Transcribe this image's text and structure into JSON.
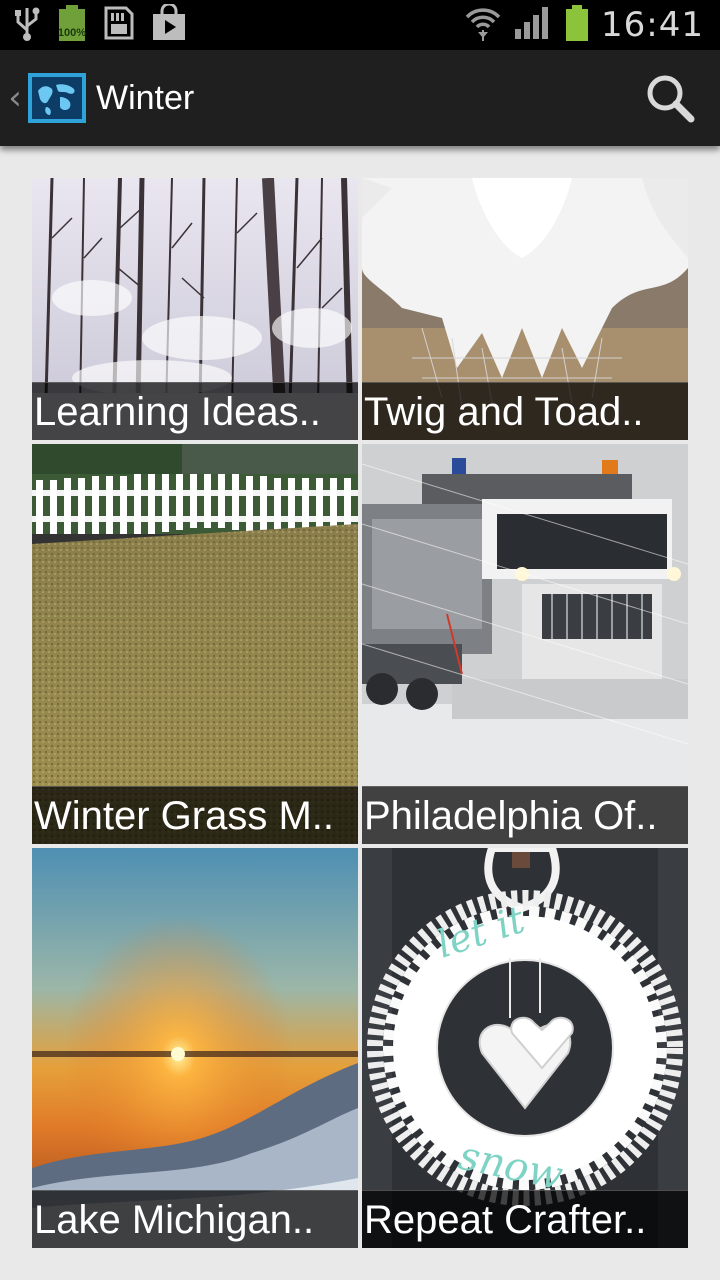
{
  "status_bar": {
    "time": "16:41",
    "battery_percent_label": "100%",
    "icons": [
      "usb-icon",
      "battery-full-icon",
      "sd-card-icon",
      "play-store-icon",
      "wifi-icon",
      "signal-icon",
      "battery-charging-icon"
    ]
  },
  "action_bar": {
    "title": "Winter",
    "up_icon": "chevron-left-icon",
    "app_icon": "globe-icon",
    "search_icon": "search-icon"
  },
  "grid": {
    "items": [
      {
        "caption": "Learning Ideas.."
      },
      {
        "caption": "Twig and Toad.."
      },
      {
        "caption": "Winter Grass M.."
      },
      {
        "caption": "Philadelphia Of.."
      },
      {
        "caption": "Lake Michigan.."
      },
      {
        "caption": "Repeat Crafter.."
      }
    ]
  },
  "colors": {
    "status_bar_bg": "#000000",
    "action_bar_bg": "#1f1f1f",
    "content_bg": "#e9e9e9",
    "accent": "#2fa3d9",
    "battery_green": "#8bc33a"
  }
}
